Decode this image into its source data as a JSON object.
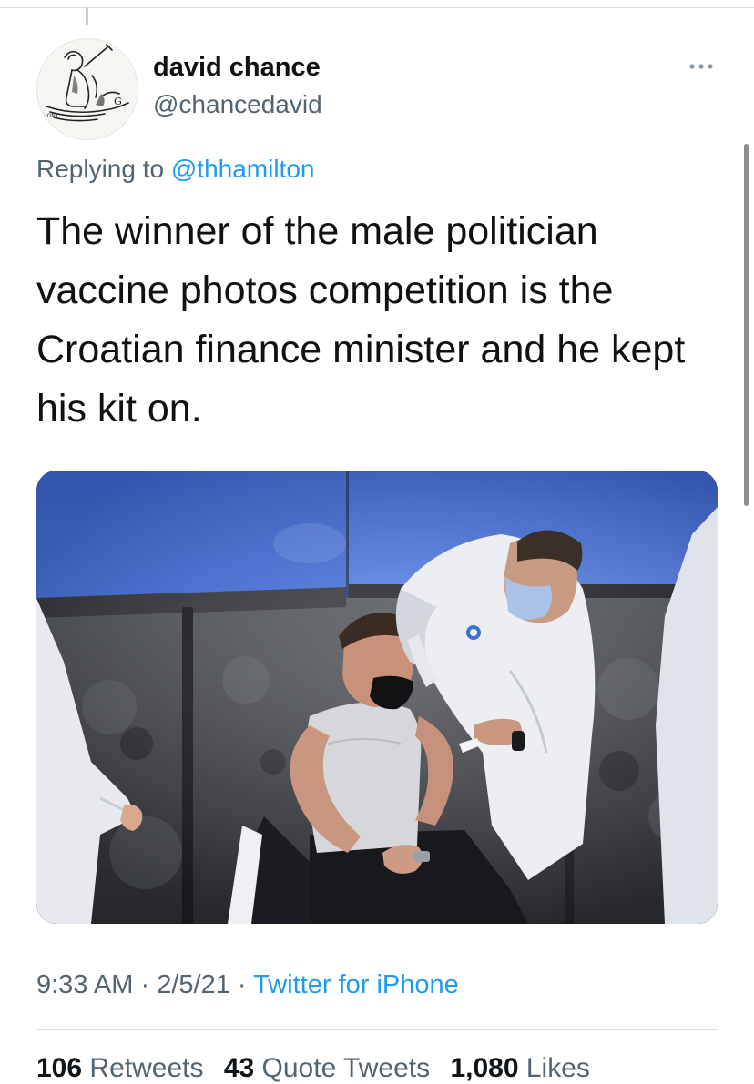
{
  "tweet": {
    "author": {
      "display_name": "david chance",
      "handle": "@chancedavid"
    },
    "reply_prefix": "Replying to",
    "reply_to": "@thhamilton",
    "text_lines": [
      "The winner of the male politician",
      "vaccine photos competition is the",
      "Croatian finance minister and he kept",
      "his kit on."
    ],
    "time": "9:33 AM",
    "date": "2/5/21",
    "separator": "·",
    "source": "Twitter for iPhone",
    "stats": {
      "retweets_count": "106",
      "retweets_label": "Retweets",
      "quotes_count": "43",
      "quotes_label": "Quote Tweets",
      "likes_count": "1,080",
      "likes_label": "Likes"
    }
  },
  "colors": {
    "link": "#1d9bf0",
    "secondary_text": "#536471",
    "primary_text": "#0f1419",
    "divider": "#d9dee2"
  },
  "icons": {
    "more": "more-horizontal-icon",
    "avatar_art": "sketch-figure-in-boat"
  }
}
